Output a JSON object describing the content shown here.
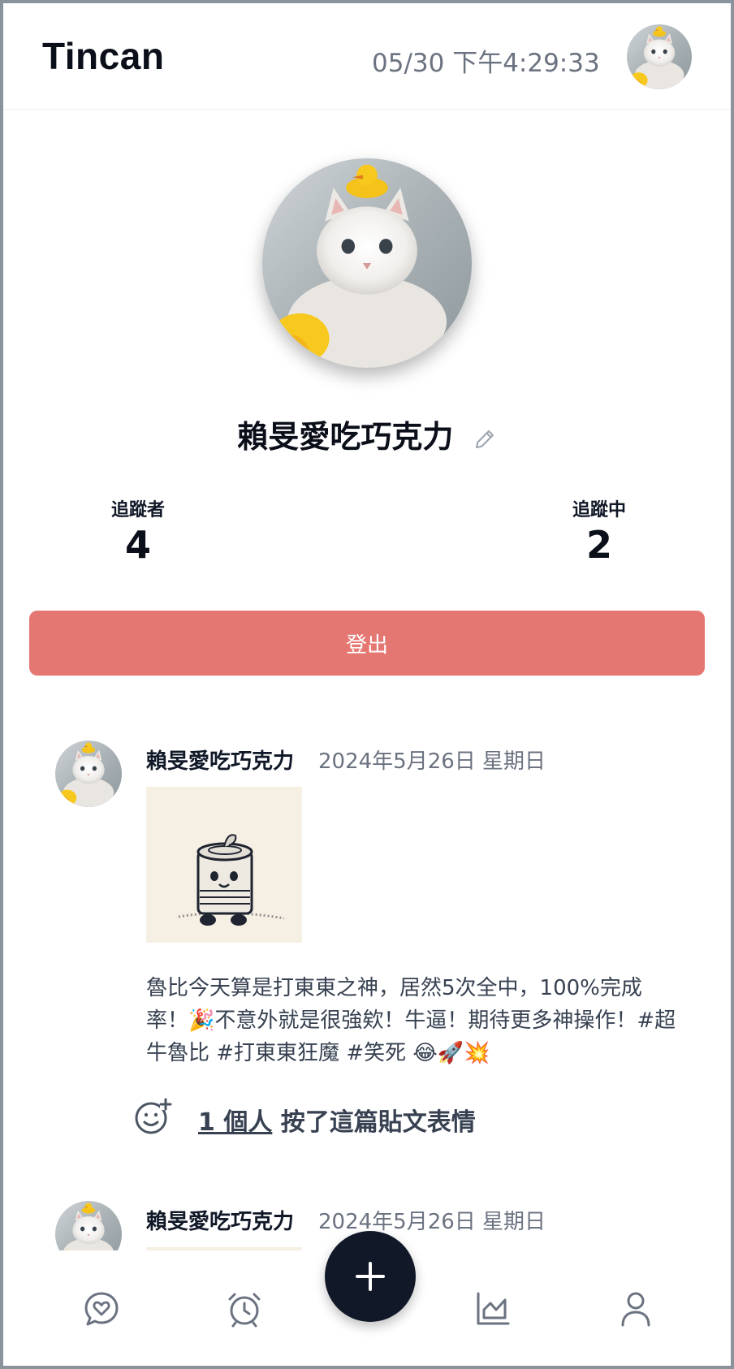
{
  "header": {
    "brand": "Tincan",
    "datetime": "05/30  下午4:29:33"
  },
  "profile": {
    "name": "賴旻愛吃巧克力",
    "followers_label": "追蹤者",
    "followers_count": "4",
    "following_label": "追蹤中",
    "following_count": "2",
    "logout_label": "登出"
  },
  "posts": [
    {
      "author": "賴旻愛吃巧克力",
      "date": "2024年5月26日 星期日",
      "text": "魯比今天算是打東東之神，居然5次全中，100%完成率！🎉不意外就是很強欸！牛逼！期待更多神操作！#超牛魯比 #打東東狂魔 #笑死 😂🚀💥",
      "reaction_count": "1 個人",
      "reaction_suffix": " 按了這篇貼文表情"
    },
    {
      "author": "賴旻愛吃巧克力",
      "date": "2024年5月26日 星期日"
    }
  ],
  "nav": {
    "items": [
      "messages-icon",
      "alarm-icon",
      "add-icon",
      "stats-icon",
      "profile-icon"
    ]
  },
  "colors": {
    "logout": "#e57772",
    "fab": "#111827",
    "muted_text": "#6b7280"
  }
}
